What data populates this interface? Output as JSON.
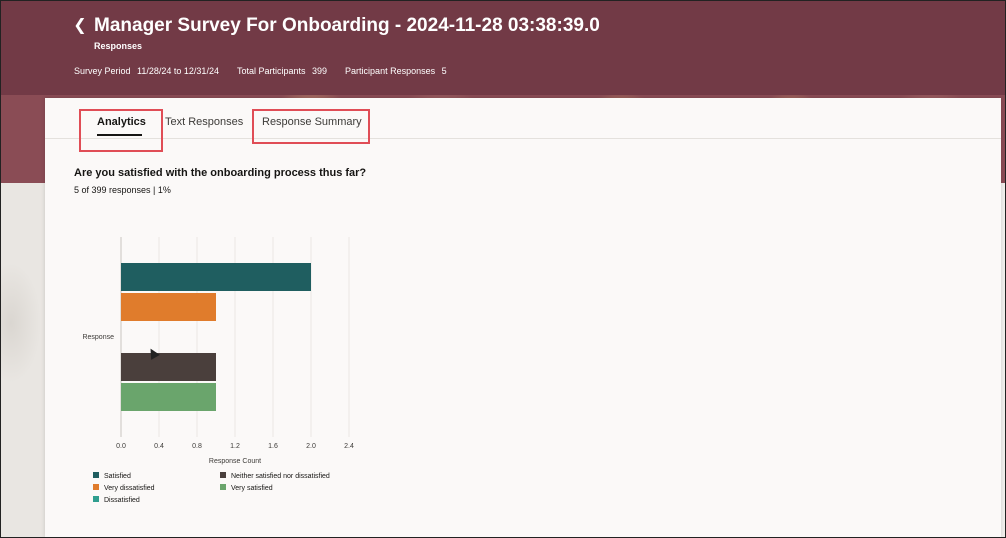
{
  "header": {
    "title": "Manager Survey For Onboarding - 2024-11-28 03:38:39.0",
    "subtitle": "Responses",
    "meta": [
      {
        "label": "Survey Period",
        "value": "11/28/24 to 12/31/24"
      },
      {
        "label": "Total Participants",
        "value": "399"
      },
      {
        "label": "Participant Responses",
        "value": "5"
      }
    ]
  },
  "tabs": [
    {
      "label": "Analytics",
      "active": true
    },
    {
      "label": "Text Responses",
      "active": false
    },
    {
      "label": "Response Summary",
      "active": false
    }
  ],
  "question": {
    "text": "Are you satisfied with the onboarding process thus far?",
    "stats": "5 of 399 responses | 1%"
  },
  "chart_data": {
    "type": "bar",
    "orientation": "horizontal",
    "xlabel": "Response Count",
    "ylabel": "Response",
    "xlim": [
      0,
      2.4
    ],
    "xticks": [
      "0.0",
      "0.4",
      "0.8",
      "1.2",
      "1.6",
      "2.0",
      "2.4"
    ],
    "grid": true,
    "legend_position": "bottom-left",
    "series": [
      {
        "name": "Satisfied",
        "value": 2,
        "color": "#1f5e60"
      },
      {
        "name": "Very dissatisfied",
        "value": 1,
        "color": "#e07c2c"
      },
      {
        "name": "Dissatisfied",
        "value": 0,
        "color": "#2f9e8f"
      },
      {
        "name": "Neither satisfied nor dissatisfied",
        "value": 1,
        "color": "#4a3f3c"
      },
      {
        "name": "Very satisfied",
        "value": 1,
        "color": "#6aa56c"
      }
    ]
  },
  "colors": {
    "header_bg": "#723a46",
    "highlight": "#e04d56"
  }
}
